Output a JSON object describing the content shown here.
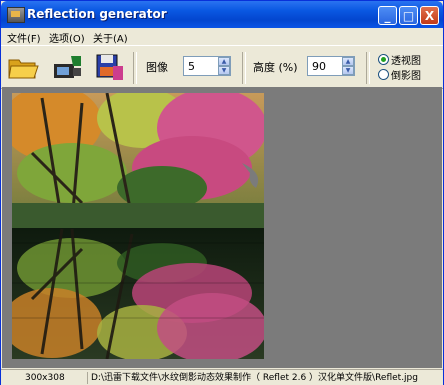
{
  "window": {
    "title": "Reflection generator",
    "minimize_glyph": "_",
    "maximize_glyph": "□",
    "close_glyph": "X"
  },
  "menu": [
    {
      "label": "文件(F)"
    },
    {
      "label": "选项(O)"
    },
    {
      "label": "关于(A)"
    }
  ],
  "toolbar": {
    "icons": [
      "open-folder-icon",
      "scan-camera-icon",
      "save-disk-icon"
    ],
    "image_label": "图像",
    "image_value": "5",
    "height_label": "高度 (%)",
    "height_value": "90",
    "mode_options": [
      {
        "label": "透视图",
        "selected": true
      },
      {
        "label": "倒影图",
        "selected": false
      }
    ]
  },
  "status": {
    "dimensions": "300x308",
    "path": "D:\\迅雷下载文件\\水纹倒影动态效果制作（ Reflet 2.6 ）汉化单文件版\\Reflet.jpg"
  },
  "colors": {
    "title_bar": "#0a58e2",
    "canvas_bg": "#7b7b7b",
    "window_bg": "#ece9d8"
  }
}
